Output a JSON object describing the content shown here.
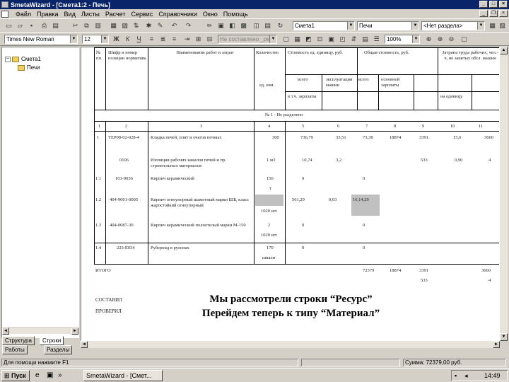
{
  "window": {
    "title": "SmetaWizard - [Смета1:2 - Печь]"
  },
  "menu": [
    "Файл",
    "Правка",
    "Вид",
    "Листы",
    "Расчет",
    "Сервис",
    "Справочники",
    "Окно",
    "Помощь"
  ],
  "toolbar1": {
    "estimate_combo": "Смета1",
    "sheet_combo": "Печи",
    "section_combo": "<Нет раздела>"
  },
  "toolbar2": {
    "font_combo": "Times New Roman",
    "size_combo": "12",
    "style_combo": "Не составлено _рег",
    "zoom_combo": "100%"
  },
  "tree": {
    "root": "Смета1",
    "child": "Печи"
  },
  "left_tabs": {
    "structure": "Структура",
    "rows": "Строки",
    "works": "Работы",
    "sections": "Разделы"
  },
  "doc": {
    "col_headers": {
      "num": "№ пп.",
      "code": "Шифр и номер позиции норматива",
      "name": "Наименование работ и затрат",
      "qty": "Количество",
      "unit_cost": "Стоимость ед. единицу, руб.",
      "total_cost": "Общая стоимость, руб.",
      "labor": "Затраты труда рабочих, чел.-ч, не занятых обсл. машин",
      "unit_meas": "ед. изм.",
      "all": "всего",
      "machine_op": "эксплуатации машин",
      "wage_main": "основной зарплаты",
      "incl_wage": "в т.ч. зарплаты",
      "per_unit": "на единицу",
      "all2": "всего"
    },
    "col_numbers": [
      "1",
      "2",
      "3",
      "4",
      "5",
      "6",
      "7",
      "8",
      "9",
      "10",
      "11"
    ],
    "section_title": "№ 1 - Не разделено",
    "rows": [
      {
        "num": "1",
        "code": "ТЕР08-02-028-4",
        "name": "Кладка печей, плит и очагов печных",
        "qty": "300",
        "v1": "736,79",
        "v2": "33,51",
        "v3": "73,38",
        "v4": "18874",
        "v5": "3391",
        "v6": "15,6",
        "v7": "3660"
      },
      {
        "num": "",
        "code": "0106",
        "name": "Изоляция рабочих каналов печей и пр. строительных материалов",
        "qty": "1 м3",
        "v1": "10,74",
        "v2": "3,2",
        "v3": "",
        "v4": "",
        "v5": "533",
        "v6": "0,90",
        "v7": "4"
      },
      {
        "num": "1.1",
        "code": "101-9036",
        "name": "Кирпич керамический",
        "qty": "150",
        "v1": "0",
        "v2": "",
        "v3": "0",
        "v4": "",
        "v5": "",
        "v6": "",
        "v7": ""
      },
      {
        "num": "1.2",
        "code": "404-9001-0005",
        "name": "Кирпич огнеупорный шамотный марки ШБ, класс жаростойкий огнеупорный",
        "qty": "1020 шт.",
        "v1": "561,29",
        "v2": "0,03",
        "v3": "16,14,29",
        "v4": "",
        "v5": "",
        "v6": "",
        "v7": ""
      },
      {
        "num": "1.3",
        "code": "404-0087-30",
        "name": "Кирпич керамический полнотелый марки М-150",
        "qty": "2",
        "v1": "0",
        "v2": "",
        "v3": "0",
        "v4": "",
        "v5": "",
        "v6": "",
        "v7": ""
      },
      {
        "num": "1.4",
        "code": "223-Е034",
        "name": "Рубероид в рулонах",
        "qty": "170",
        "v1": "0",
        "v2": "",
        "v3": "0",
        "v4": "",
        "v5": "",
        "v6": "",
        "v7": ""
      }
    ],
    "qty_sub": {
      "r1": "т",
      "r2": "1020 шт.",
      "r3": "1020 шт.",
      "r4": "шпали"
    },
    "total_label": "ИТОГО",
    "totals": {
      "a": "72379",
      "b": "18874",
      "c": "3391",
      "d": "3660",
      "e": "533",
      "f": "4"
    },
    "signatures": {
      "made": "СОСТАВИЛ",
      "checked": "ПРОВЕРИЛ"
    },
    "overlay_line1": "Мы рассмотрели строки “Ресурс”",
    "overlay_line2": "Перейдем теперь к типу “Материал”"
  },
  "status": {
    "help": "Для помощи нажмите F1",
    "sum": "Сумма: 72379,00 руб."
  },
  "taskbar": {
    "start": "Пуск",
    "task": "SmetaWizard - [Смет...",
    "clock": "14:49"
  }
}
